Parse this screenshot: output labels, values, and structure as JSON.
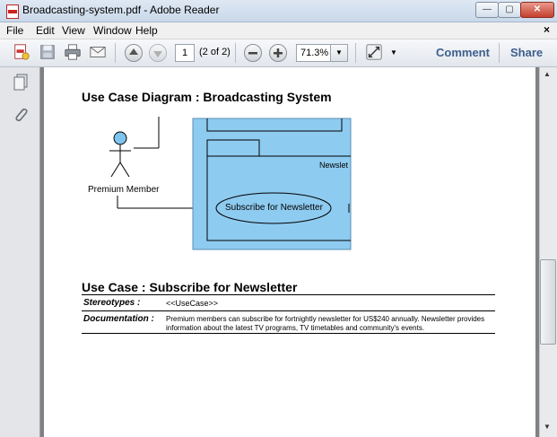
{
  "window": {
    "title": "Broadcasting-system.pdf - Adobe Reader",
    "minimize": "—",
    "restore": "▢",
    "close": "✕"
  },
  "menu": {
    "items": [
      "File",
      "Edit",
      "View",
      "Window",
      "Help"
    ],
    "close": "×"
  },
  "toolbar": {
    "page_number": "1",
    "page_count": "(2 of 2)",
    "zoom": "71.3%",
    "comment": "Comment",
    "share": "Share"
  },
  "document": {
    "diagram_heading": "Use Case Diagram : Broadcasting System",
    "actor_label": "Premium Member",
    "package_label": "Newslet",
    "usecase_label": "Subscribe for Newsletter",
    "usecase_heading": "Use Case : Subscribe for Newsletter",
    "stereotypes_label": "Stereotypes :",
    "stereotypes_value": "<<UseCase>>",
    "documentation_label": "Documentation :",
    "documentation_value": "Premium members can subscribe for fortnightly newsletter for US$240 annually. Newsletter provides information about the latest TV programs, TV timetables and community's events."
  },
  "colors": {
    "diagram_fill": "#8ecbf0",
    "actor_head": "#7ec4ef",
    "accent_link": "#3d5f8e"
  }
}
